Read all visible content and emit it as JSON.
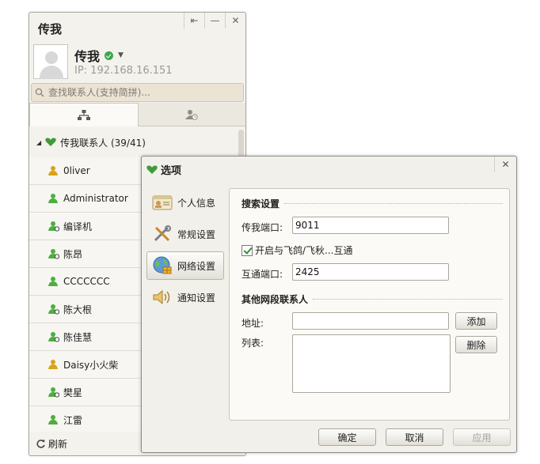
{
  "main_window": {
    "title": "传我",
    "controls": [
      "⇤",
      "—",
      "✕"
    ],
    "username": "传我",
    "ip": "IP: 192.168.16.151",
    "search_placeholder": "查找联系人(支持简拼)...",
    "group": "传我联系人 (39/41)",
    "contacts": [
      {
        "name": "0liver",
        "icon": "user-online-icon"
      },
      {
        "name": "Administrator",
        "icon": "user-icon"
      },
      {
        "name": "编译机",
        "icon": "user-offline-icon"
      },
      {
        "name": "陈昂",
        "icon": "user-offline-icon"
      },
      {
        "name": "CCCCCCC",
        "icon": "user-icon"
      },
      {
        "name": "陈大根",
        "icon": "user-offline-icon"
      },
      {
        "name": "陈佳慧",
        "icon": "user-offline-icon"
      },
      {
        "name": "Daisy小火柴",
        "icon": "user-online-icon"
      },
      {
        "name": "樊星",
        "icon": "user-offline-icon"
      },
      {
        "name": "江雷",
        "icon": "user-icon"
      }
    ],
    "refresh_label": "刷新"
  },
  "dialog": {
    "title": "选项",
    "close": "✕",
    "nav": [
      {
        "label": "个人信息",
        "icon": "id-card-icon"
      },
      {
        "label": "常规设置",
        "icon": "tools-icon"
      },
      {
        "label": "网络设置",
        "icon": "network-icon"
      },
      {
        "label": "通知设置",
        "icon": "speaker-icon"
      }
    ],
    "search_section": "搜索设置",
    "port_label": "传我端口:",
    "port_value": "9011",
    "interop_checkbox": "开启与飞鸽/飞秋...互通",
    "interop_port_label": "互通端口:",
    "interop_port_value": "2425",
    "other_section": "其他网段联系人",
    "address_label": "地址:",
    "address_value": "",
    "list_label": "列表:",
    "add_button": "添加",
    "delete_button": "删除",
    "ok_button": "确定",
    "cancel_button": "取消",
    "apply_button": "应用"
  },
  "colors": {
    "online_user": "#d9a21a",
    "default_user": "#4caf3f",
    "status_online": "#3aa84a"
  }
}
